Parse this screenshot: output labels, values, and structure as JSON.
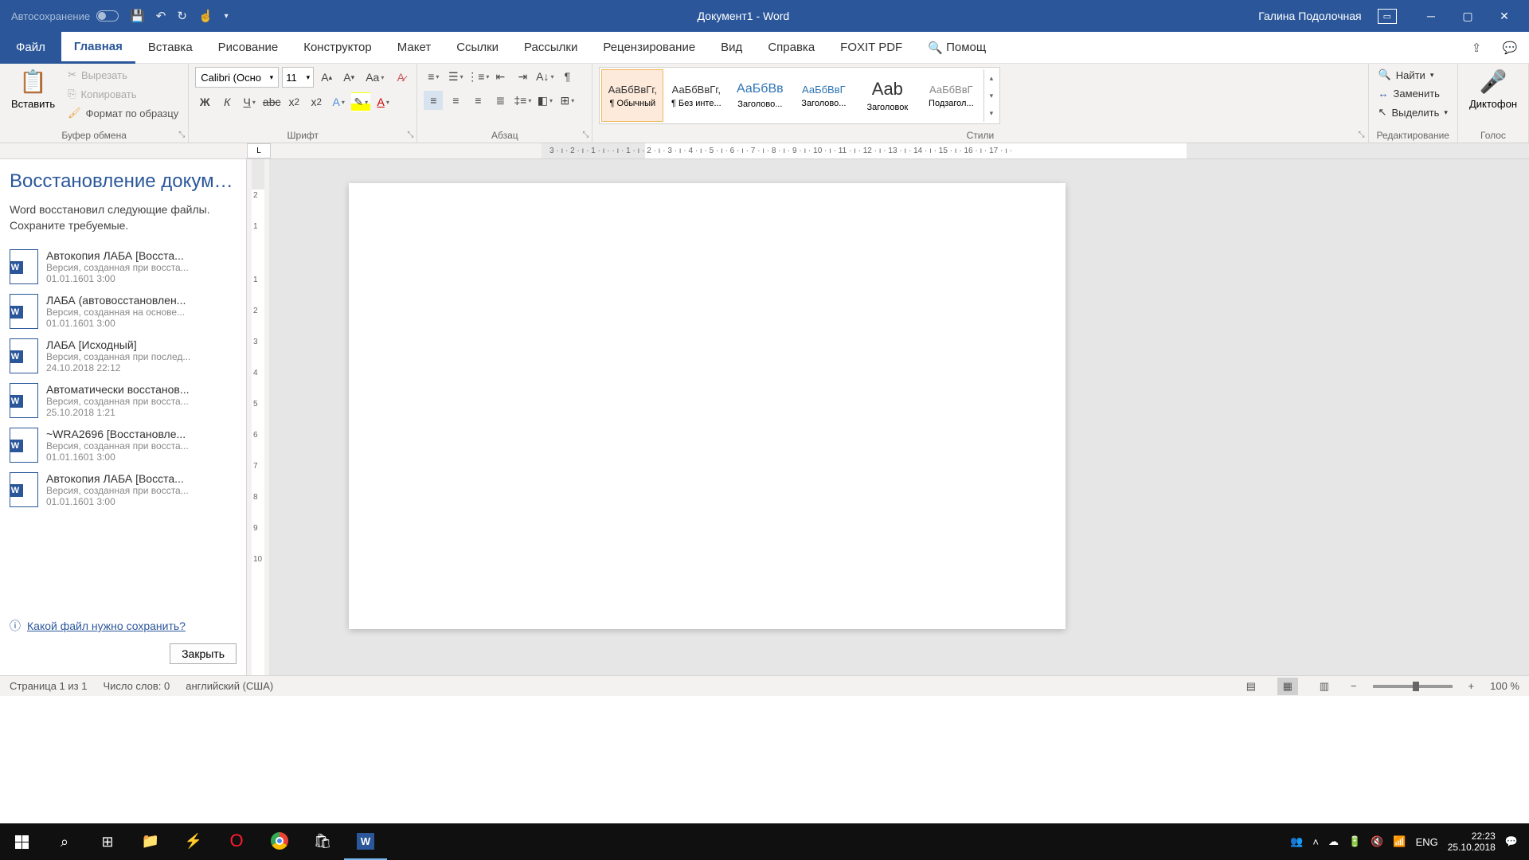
{
  "titlebar": {
    "autosave": "Автосохранение",
    "doc_title": "Документ1  -  Word",
    "username": "Галина Подолочная"
  },
  "tabs": {
    "file": "Файл",
    "home": "Главная",
    "insert": "Вставка",
    "draw": "Рисование",
    "design": "Конструктор",
    "layout": "Макет",
    "references": "Ссылки",
    "mailings": "Рассылки",
    "review": "Рецензирование",
    "view": "Вид",
    "help": "Справка",
    "foxit": "FOXIT PDF",
    "tellme": "Помощ"
  },
  "ribbon": {
    "clipboard": {
      "label": "Буфер обмена",
      "paste": "Вставить",
      "cut": "Вырезать",
      "copy": "Копировать",
      "format_painter": "Формат по образцу"
    },
    "font": {
      "label": "Шрифт",
      "name": "Calibri (Осно",
      "size": "11"
    },
    "paragraph": {
      "label": "Абзац"
    },
    "styles": {
      "label": "Стили",
      "items": [
        {
          "sample": "АаБбВвГг,",
          "name": "¶ Обычный"
        },
        {
          "sample": "АаБбВвГг,",
          "name": "¶ Без инте..."
        },
        {
          "sample": "АаБбВв",
          "name": "Заголово..."
        },
        {
          "sample": "АаБбВвГ",
          "name": "Заголово..."
        },
        {
          "sample": "Aab",
          "name": "Заголовок"
        },
        {
          "sample": "АаБбВвГ",
          "name": "Подзагол..."
        }
      ]
    },
    "editing": {
      "label": "Редактирование",
      "find": "Найти",
      "replace": "Заменить",
      "select": "Выделить"
    },
    "voice": {
      "label": "Голос",
      "dictation": "Диктофон"
    }
  },
  "recovery": {
    "title": "Восстановление докумен...",
    "message1": "Word восстановил следующие файлы.",
    "message2": "Сохраните требуемые.",
    "items": [
      {
        "name": "Автокопия ЛАБА  [Восста...",
        "desc": "Версия, созданная при восста...",
        "date": "01.01.1601 3:00"
      },
      {
        "name": "ЛАБА  (автовосстановлен...",
        "desc": "Версия, созданная на основе...",
        "date": "01.01.1601 3:00"
      },
      {
        "name": "ЛАБА  [Исходный]",
        "desc": "Версия, созданная при послед...",
        "date": "24.10.2018 22:12"
      },
      {
        "name": "Автоматически восстанов...",
        "desc": "Версия, созданная при восста...",
        "date": "25.10.2018 1:21"
      },
      {
        "name": "~WRA2696  [Восстановле...",
        "desc": "Версия, созданная при восста...",
        "date": "01.01.1601 3:00"
      },
      {
        "name": "Автокопия ЛАБА  [Восста...",
        "desc": "Версия, созданная при восста...",
        "date": "01.01.1601 3:00"
      }
    ],
    "help": "Какой файл нужно сохранить?",
    "close": "Закрыть"
  },
  "statusbar": {
    "page": "Страница 1 из 1",
    "words": "Число слов: 0",
    "lang": "английский (США)",
    "zoom": "100 %"
  },
  "taskbar": {
    "lang": "ENG",
    "time": "22:23",
    "date": "25.10.2018"
  },
  "ruler": "3 · ı · 2 · ı · 1 · ı ·   · ı · 1 · ı · 2 · ı · 3 · ı · 4 · ı · 5 · ı · 6 · ı · 7 · ı · 8 · ı · 9 · ı · 10 · ı · 11 · ı · 12 · ı · 13 · ı · 14 · ı · 15 · ı · 16 · ı · 17 · ı ·"
}
